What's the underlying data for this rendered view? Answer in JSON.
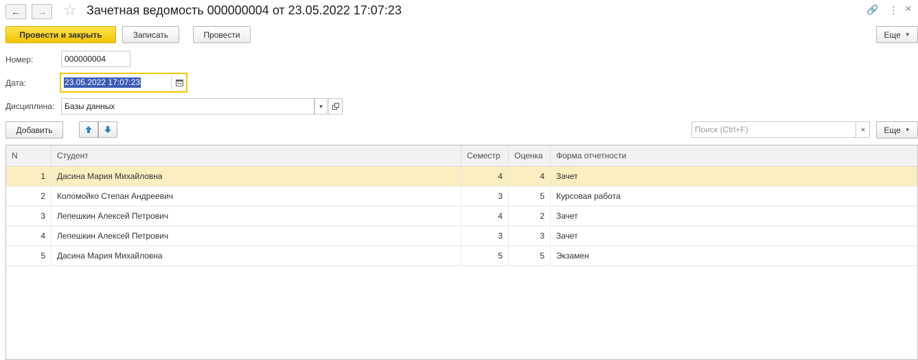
{
  "window": {
    "title": "Зачетная ведомость 000000004 от 23.05.2022 17:07:23",
    "back_icon": "←",
    "forward_icon": "→",
    "star_icon": "☆",
    "link_icon": "🔗",
    "more_icon": "⋮",
    "close_icon": "×"
  },
  "toolbar": {
    "post_close_label": "Провести и закрыть",
    "save_label": "Записать",
    "post_label": "Провести",
    "more_label": "Еще"
  },
  "form": {
    "number_label": "Номер:",
    "number_value": "000000004",
    "date_label": "Дата:",
    "date_value": "23.05.2022 17:07:23",
    "discipline_label": "Дисциплина:",
    "discipline_value": "Базы данных"
  },
  "table_toolbar": {
    "add_label": "Добавить",
    "search_placeholder": "Поиск (Ctrl+F)",
    "more_label": "Еще"
  },
  "table": {
    "columns": [
      "N",
      "Студент",
      "Семестр",
      "Оценка",
      "Форма отчетности"
    ],
    "rows": [
      {
        "n": "1",
        "student": "Дасина Мария Михайловна",
        "semester": "4",
        "grade": "4",
        "form": "Зачет"
      },
      {
        "n": "2",
        "student": "Коломойко Степан Андреевич",
        "semester": "3",
        "grade": "5",
        "form": "Курсовая работа"
      },
      {
        "n": "3",
        "student": "Лепешкин Алексей Петрович",
        "semester": "4",
        "grade": "2",
        "form": "Зачет"
      },
      {
        "n": "4",
        "student": "Лепешкин Алексей Петрович",
        "semester": "3",
        "grade": "3",
        "form": "Зачет"
      },
      {
        "n": "5",
        "student": "Дасина Мария Михайловна",
        "semester": "5",
        "grade": "5",
        "form": "Экзамен"
      }
    ]
  },
  "colors": {
    "accent": "#f2c500",
    "selected_row": "#fbeec0",
    "selection": "#3b5ab6"
  }
}
